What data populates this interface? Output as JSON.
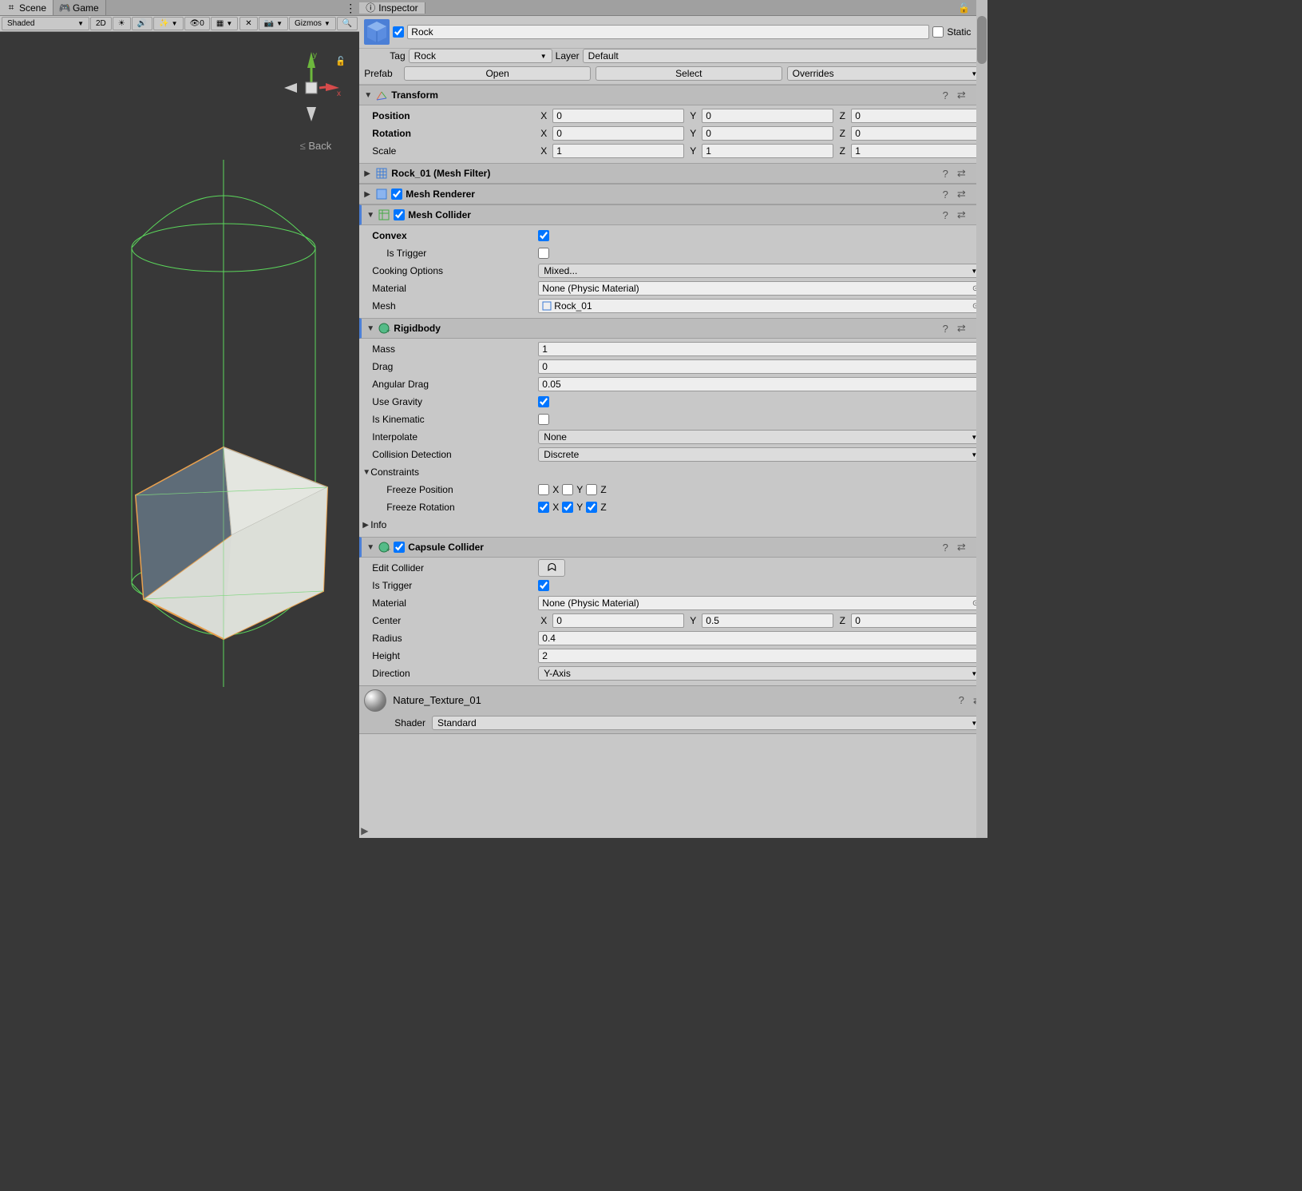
{
  "leftTabs": {
    "scene": "Scene",
    "game": "Game"
  },
  "sceneToolbar": {
    "shading": "Shaded",
    "btn2D": "2D",
    "hiddenCount": "0",
    "gizmos": "Gizmos"
  },
  "viewport": {
    "backLabel": "Back",
    "axis_x": "x",
    "axis_y": "y"
  },
  "inspector": {
    "title": "Inspector",
    "nameChecked": true,
    "name": "Rock",
    "staticLabel": "Static",
    "tagLabel": "Tag",
    "tagValue": "Rock",
    "layerLabel": "Layer",
    "layerValue": "Default",
    "prefab": {
      "label": "Prefab",
      "open": "Open",
      "select": "Select",
      "overrides": "Overrides"
    }
  },
  "transform": {
    "title": "Transform",
    "position": {
      "label": "Position",
      "x": "0",
      "y": "0",
      "z": "0"
    },
    "rotation": {
      "label": "Rotation",
      "x": "0",
      "y": "0",
      "z": "0"
    },
    "scale": {
      "label": "Scale",
      "x": "1",
      "y": "1",
      "z": "1"
    }
  },
  "meshFilter": {
    "title": "Rock_01 (Mesh Filter)"
  },
  "meshRenderer": {
    "title": "Mesh Renderer",
    "enabled": true
  },
  "meshCollider": {
    "title": "Mesh Collider",
    "enabled": true,
    "convexLabel": "Convex",
    "convex": true,
    "isTriggerLabel": "Is Trigger",
    "isTrigger": false,
    "cookingLabel": "Cooking Options",
    "cookingValue": "Mixed...",
    "materialLabel": "Material",
    "materialValue": "None (Physic Material)",
    "meshLabel": "Mesh",
    "meshValue": "Rock_01"
  },
  "rigidbody": {
    "title": "Rigidbody",
    "massLabel": "Mass",
    "mass": "1",
    "dragLabel": "Drag",
    "drag": "0",
    "angularDragLabel": "Angular Drag",
    "angularDrag": "0.05",
    "useGravityLabel": "Use Gravity",
    "useGravity": true,
    "isKinematicLabel": "Is Kinematic",
    "isKinematic": false,
    "interpolateLabel": "Interpolate",
    "interpolate": "None",
    "collisionLabel": "Collision Detection",
    "collision": "Discrete",
    "constraintsLabel": "Constraints",
    "freezePosLabel": "Freeze Position",
    "freezePos": {
      "x": false,
      "y": false,
      "z": false
    },
    "freezeRotLabel": "Freeze Rotation",
    "freezeRot": {
      "x": true,
      "y": true,
      "z": true
    },
    "infoLabel": "Info"
  },
  "capsule": {
    "title": "Capsule Collider",
    "enabled": true,
    "editLabel": "Edit Collider",
    "isTriggerLabel": "Is Trigger",
    "isTrigger": true,
    "materialLabel": "Material",
    "materialValue": "None (Physic Material)",
    "centerLabel": "Center",
    "center": {
      "x": "0",
      "y": "0.5",
      "z": "0"
    },
    "radiusLabel": "Radius",
    "radius": "0.4",
    "heightLabel": "Height",
    "height": "2",
    "directionLabel": "Direction",
    "direction": "Y-Axis"
  },
  "material": {
    "name": "Nature_Texture_01",
    "shaderLabel": "Shader",
    "shaderValue": "Standard"
  },
  "labels": {
    "x": "X",
    "y": "Y",
    "z": "Z"
  }
}
